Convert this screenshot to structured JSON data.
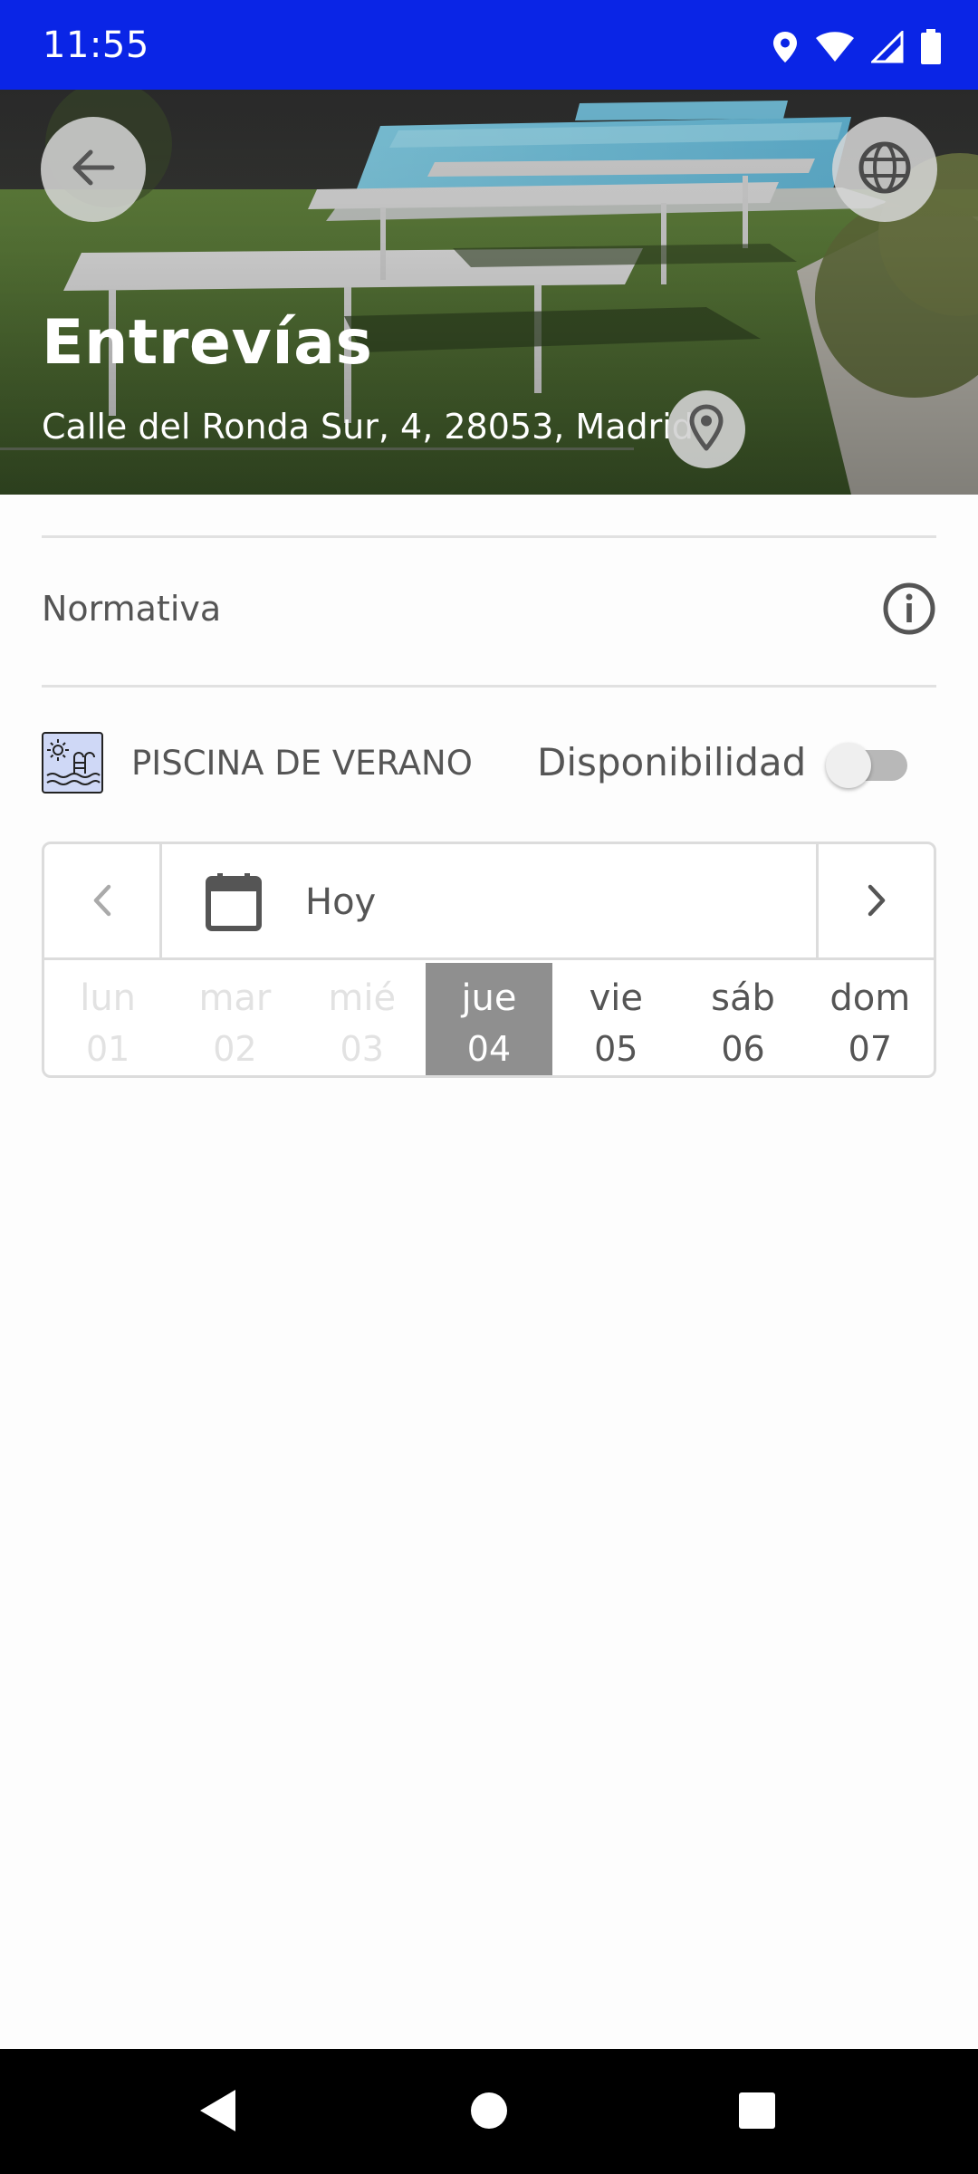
{
  "status_bar": {
    "time": "11:55",
    "background": "#0a25e6",
    "icons": [
      "location-icon",
      "wifi-icon",
      "cell-signal-icon",
      "battery-icon"
    ]
  },
  "header": {
    "title": "Entrevías",
    "address": "Calle del Ronda Sur, 4, 28053, Madrid",
    "back_icon": "arrow-left-icon",
    "web_icon": "globe-icon",
    "map_icon": "map-pin-icon"
  },
  "rules": {
    "label": "Normativa",
    "icon": "info-icon"
  },
  "facility": {
    "name": "PISCINA DE VERANO",
    "icon": "summer-pool-icon",
    "availability_label": "Disponibilidad",
    "availability_on": false
  },
  "calendar": {
    "today_label": "Hoy",
    "prev_icon": "chevron-left-icon",
    "next_icon": "chevron-right-icon",
    "calendar_icon": "calendar-icon",
    "days": [
      {
        "name": "lun",
        "num": "01",
        "state": "past"
      },
      {
        "name": "mar",
        "num": "02",
        "state": "past"
      },
      {
        "name": "mié",
        "num": "03",
        "state": "past"
      },
      {
        "name": "jue",
        "num": "04",
        "state": "selected"
      },
      {
        "name": "vie",
        "num": "05",
        "state": "normal"
      },
      {
        "name": "sáb",
        "num": "06",
        "state": "normal"
      },
      {
        "name": "dom",
        "num": "07",
        "state": "normal"
      }
    ],
    "selected_color": "#8f8f8f"
  },
  "nav_bar": {
    "buttons": [
      "nav-back-icon",
      "nav-home-icon",
      "nav-recents-icon"
    ]
  }
}
